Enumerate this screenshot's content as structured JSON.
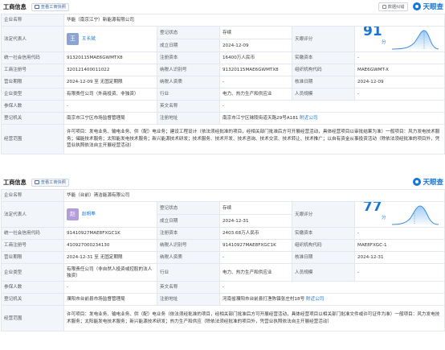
{
  "sections": [
    {
      "title": "工商信息",
      "snapshot_label": "查看工商快照",
      "tools": {
        "export_label": "数据纠错",
        "logo_text": "天眼查"
      },
      "company_name_label": "企业名称",
      "company_name": "华能（南京江宁）新能源有限公司",
      "legal_rep_label": "法定代表人",
      "legal_rep_avatar": "王",
      "legal_rep_avatar_color": "#8aa4d6",
      "legal_rep": "王长斌",
      "reg_status_label": "登记状态",
      "reg_status": "存续",
      "founded_label": "成立日期",
      "founded": "2024-12-09",
      "score_label": "天眼评分",
      "score": "91",
      "score_unit": "分",
      "rows": [
        [
          [
            "统一社会信用代码",
            "91320115MAE6GWMTX8"
          ],
          [
            "注册资本",
            "16400万人民币"
          ],
          [
            "实缴资本",
            "-"
          ]
        ],
        [
          [
            "工商注册号",
            "320121400011022"
          ],
          [
            "纳税人识别号",
            "91320115MAE6GWMTX8"
          ],
          [
            "组织机构代码",
            "MAE6GWMT-X"
          ]
        ],
        [
          [
            "营业期限",
            "2024-12-09 至 无固定期限"
          ],
          [
            "纳税人资质",
            "-"
          ],
          [
            "核准日期",
            "2024-12-09"
          ]
        ],
        [
          [
            "企业类型",
            "有限责任公司（外商投资、非独资）"
          ],
          [
            "行业",
            "电力、热力生产和供应业"
          ],
          [
            "人员规模",
            "-"
          ]
        ],
        [
          [
            "参保人数",
            "-"
          ],
          [
            "英文名称",
            "-"
          ],
          [
            "",
            ""
          ]
        ],
        [
          [
            "登记机关",
            "南京市江宁区市场监督管理局"
          ],
          [
            "注册地址",
            "南京市江宁区秣陵街道天路29号A181"
          ],
          [
            "",
            ""
          ]
        ]
      ],
      "address_link": "附近公司",
      "scope_label": "经营范围",
      "scope": "许可项目：发电业务、输电业务、供（配）电业务；建设工程设计（依法须经批准的项目，经相关部门批准后方可开展经营活动，具体经营项目以审批结果为准）一般项目：风力发电技术服务；储能技术服务；太阳能发电技术服务；新兴能源技术研发；技术服务、技术开发、技术咨询、技术交流、技术转让、技术推广；以自有资金从事投资活动（除依法须经批准的项目外，凭营业执照依法自主开展经营活动）"
    },
    {
      "title": "工商信息",
      "snapshot_label": "查看工商快照",
      "tools": {
        "export_label": "",
        "logo_text": "天眼查"
      },
      "company_name_label": "企业名称",
      "company_name": "华能（台前）清洁能源有限公司",
      "legal_rep_label": "法定代表人",
      "legal_rep_avatar": "赵",
      "legal_rep_avatar_color": "#b39ddb",
      "legal_rep": "赵明奉",
      "reg_status_label": "登记状态",
      "reg_status": "存续",
      "founded_label": "成立日期",
      "founded": "2024-12-31",
      "score_label": "天眼评分",
      "score": "77",
      "score_unit": "分",
      "rows": [
        [
          [
            "统一社会信用代码",
            "91410927MAE8FXGC1K"
          ],
          [
            "注册资本",
            "2403.68万人民币"
          ],
          [
            "实缴资本",
            "-"
          ]
        ],
        [
          [
            "工商注册号",
            "410927000234130"
          ],
          [
            "纳税人识别号",
            "91410927MAE8FXGC1K"
          ],
          [
            "组织机构代码",
            "MAE8FXGC-1"
          ]
        ],
        [
          [
            "营业期限",
            "2024-12-31 至 无固定期限"
          ],
          [
            "纳税人资质",
            "-"
          ],
          [
            "核准日期",
            "2024-12-31"
          ]
        ],
        [
          [
            "企业类型",
            "有限责任公司（非自然人投资或控股的法人独资）"
          ],
          [
            "行业",
            "电力、热力生产和供应业"
          ],
          [
            "人员规模",
            "-"
          ]
        ],
        [
          [
            "参保人数",
            "-"
          ],
          [
            "英文名称",
            "-"
          ],
          [
            "",
            ""
          ]
        ],
        [
          [
            "登记机关",
            "濮阳市台前县市场监督管理局"
          ],
          [
            "注册地址",
            "河南省濮阳市台前县打渔陈镇张庄村18号"
          ],
          [
            "",
            ""
          ]
        ]
      ],
      "address_link": "附近公司",
      "scope_label": "经营范围",
      "scope": "许可项目：发电业务、输电业务、供（配）电业务（依法须经批准的项目，经相关部门批准后方可开展经营活动，具体经营项目以相关部门批准文件或许可证件为准）一般项目：风力发电技术服务；太阳能发电技术服务；新兴能源技术研发；热力生产和供应（除依法须经批准的项目外，凭营业执照依法自主开展经营活动）"
    }
  ]
}
